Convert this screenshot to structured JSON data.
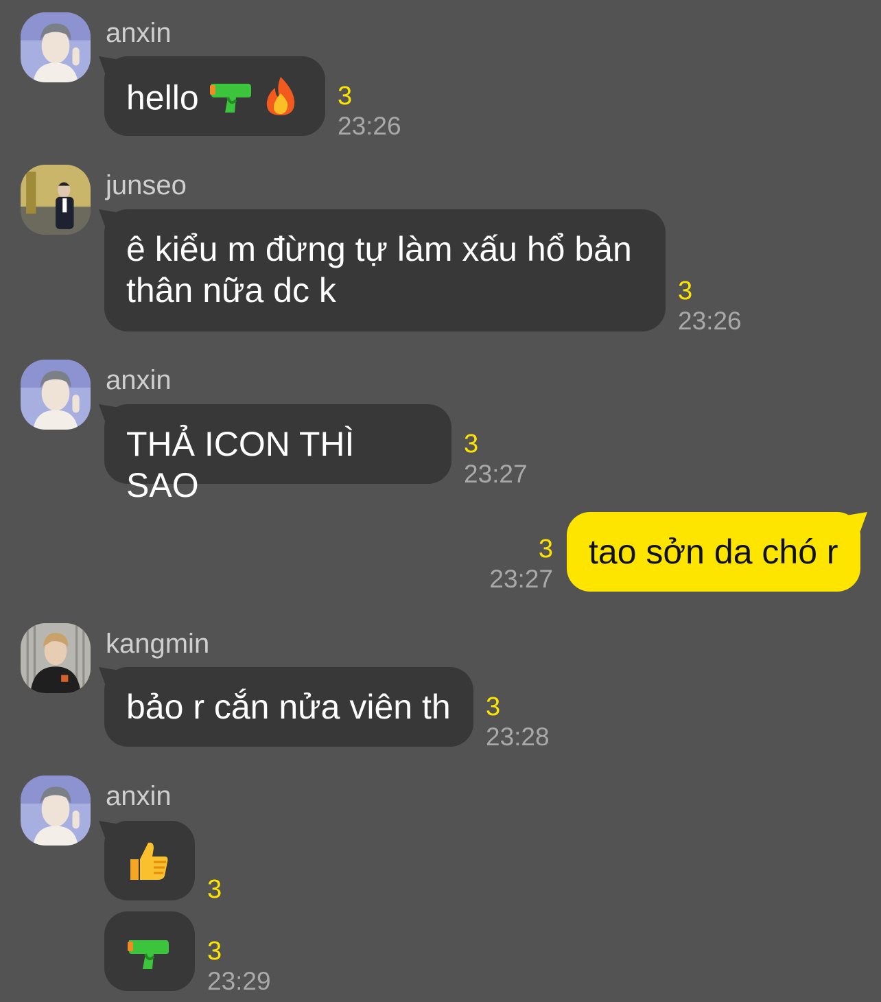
{
  "messages": [
    {
      "sender": "anxin",
      "text": "hello",
      "unread": "3",
      "time": "23:26",
      "emojis": [
        "water-pistol-icon",
        "fire-icon"
      ]
    },
    {
      "sender": "junseo",
      "line1": "ê kiểu m đừng tự làm xấu hổ bản",
      "line2": "thân nữa dc k",
      "unread": "3",
      "time": "23:26"
    },
    {
      "sender": "anxin",
      "text": "THẢ ICON THÌ SAO",
      "unread": "3",
      "time": "23:27"
    },
    {
      "sender": "me",
      "text": "tao sởn da chó r",
      "unread": "3",
      "time": "23:27"
    },
    {
      "sender": "kangmin",
      "text": "bảo r cắn nửa viên th",
      "unread": "3",
      "time": "23:28"
    },
    {
      "sender": "anxin",
      "emoji": "thumbs-up-icon",
      "unread": "3"
    },
    {
      "sender": "anxin",
      "emoji": "water-pistol-icon",
      "unread": "3",
      "time": "23:29"
    }
  ],
  "colors": {
    "background": "#545354",
    "incoming_bubble": "#383838",
    "outgoing_bubble": "#fee500",
    "unread": "#fee500",
    "time": "#a9a9a9"
  }
}
